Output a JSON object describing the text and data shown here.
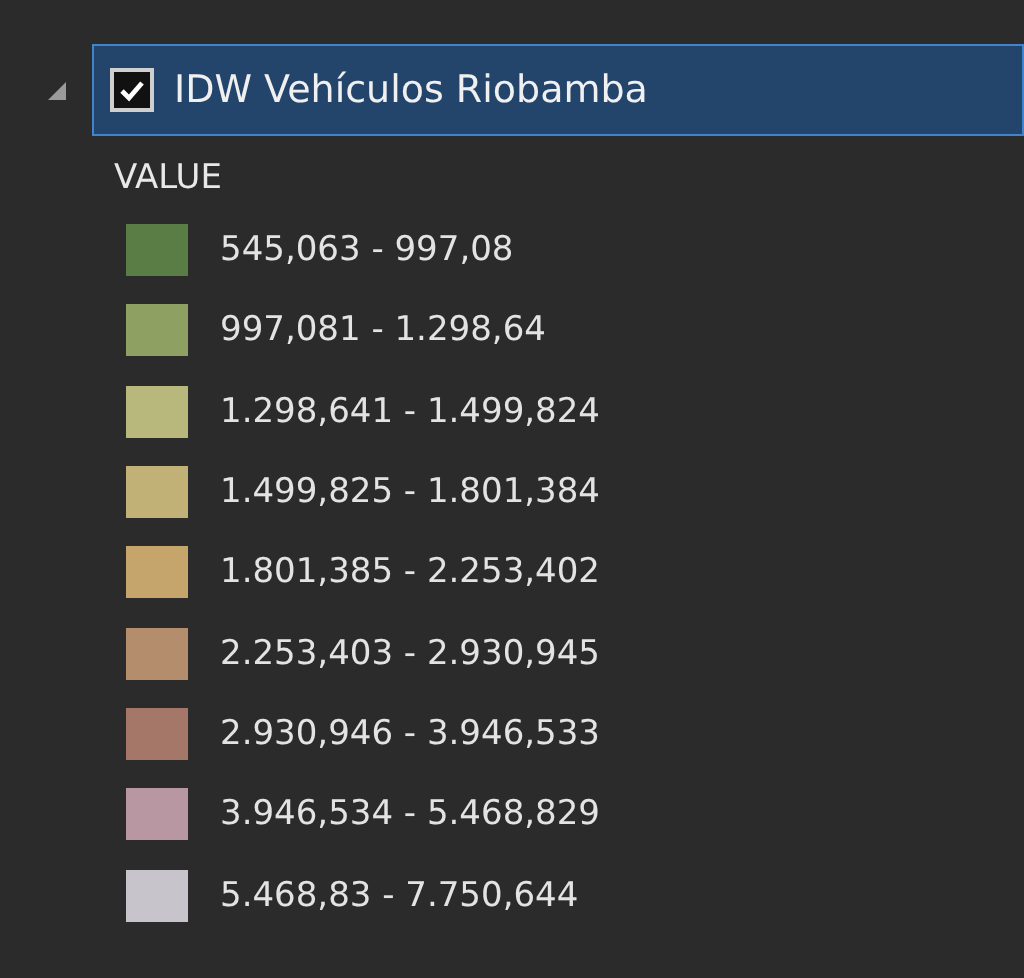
{
  "layer": {
    "name": "IDW Vehículos Riobamba",
    "checked": true,
    "expanded": true,
    "selected": true
  },
  "field": "VALUE",
  "classes": [
    {
      "label": "545,063 - 997,08",
      "color": "#5a7d45"
    },
    {
      "label": "997,081 - 1.298,64",
      "color": "#8fa063"
    },
    {
      "label": "1.298,641 - 1.499,824",
      "color": "#b8b77c"
    },
    {
      "label": "1.499,825 - 1.801,384",
      "color": "#c2b176"
    },
    {
      "label": "1.801,385 - 2.253,402",
      "color": "#c5a56c"
    },
    {
      "label": "2.253,403 - 2.930,945",
      "color": "#b48e6c"
    },
    {
      "label": "2.930,946 - 3.946,533",
      "color": "#a57769"
    },
    {
      "label": "3.946,534 - 5.468,829",
      "color": "#b897a3"
    },
    {
      "label": "5.468,83 - 7.750,644",
      "color": "#c7c4cc"
    }
  ]
}
